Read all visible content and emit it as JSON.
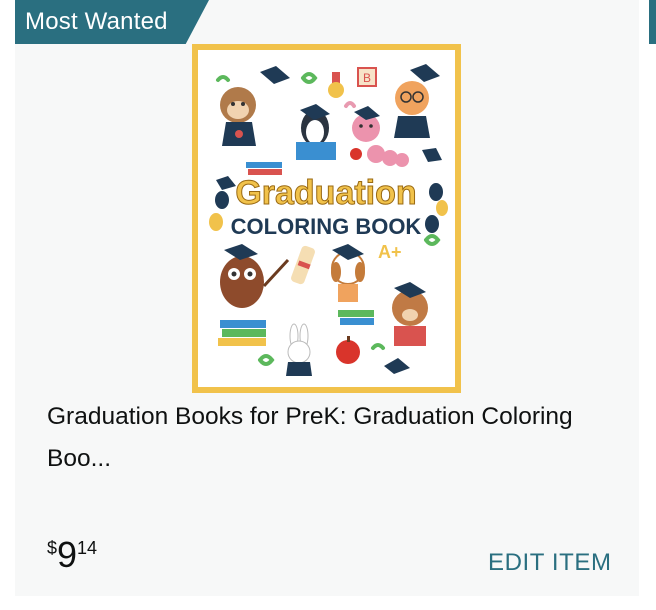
{
  "badge": {
    "label": "Most Wanted"
  },
  "product": {
    "title": "Graduation Books for PreK: Graduation Coloring Boo...",
    "cover": {
      "title_line1": "Graduation",
      "title_line2": "COLORING BOOK",
      "icons": [
        "monkey-graduate-icon",
        "penguin-reading-icon",
        "worm-graduate-icon",
        "cat-graduate-icon",
        "owl-graduate-icon",
        "dog-graduate-icon",
        "bear-reading-icon",
        "rabbit-graduate-icon",
        "apple-icon",
        "balloon-icon",
        "diploma-icon",
        "book-stack-icon",
        "grad-cap-icon",
        "medal-icon",
        "abc-block-icon"
      ]
    },
    "price": {
      "symbol": "$",
      "whole": "9",
      "fraction": "14"
    }
  },
  "actions": {
    "edit_label": "EDIT ITEM"
  },
  "colors": {
    "accent": "#2a6f80",
    "cover_border": "#f1c24b",
    "card_bg": "#f7f8f8",
    "text": "#0f1111"
  }
}
